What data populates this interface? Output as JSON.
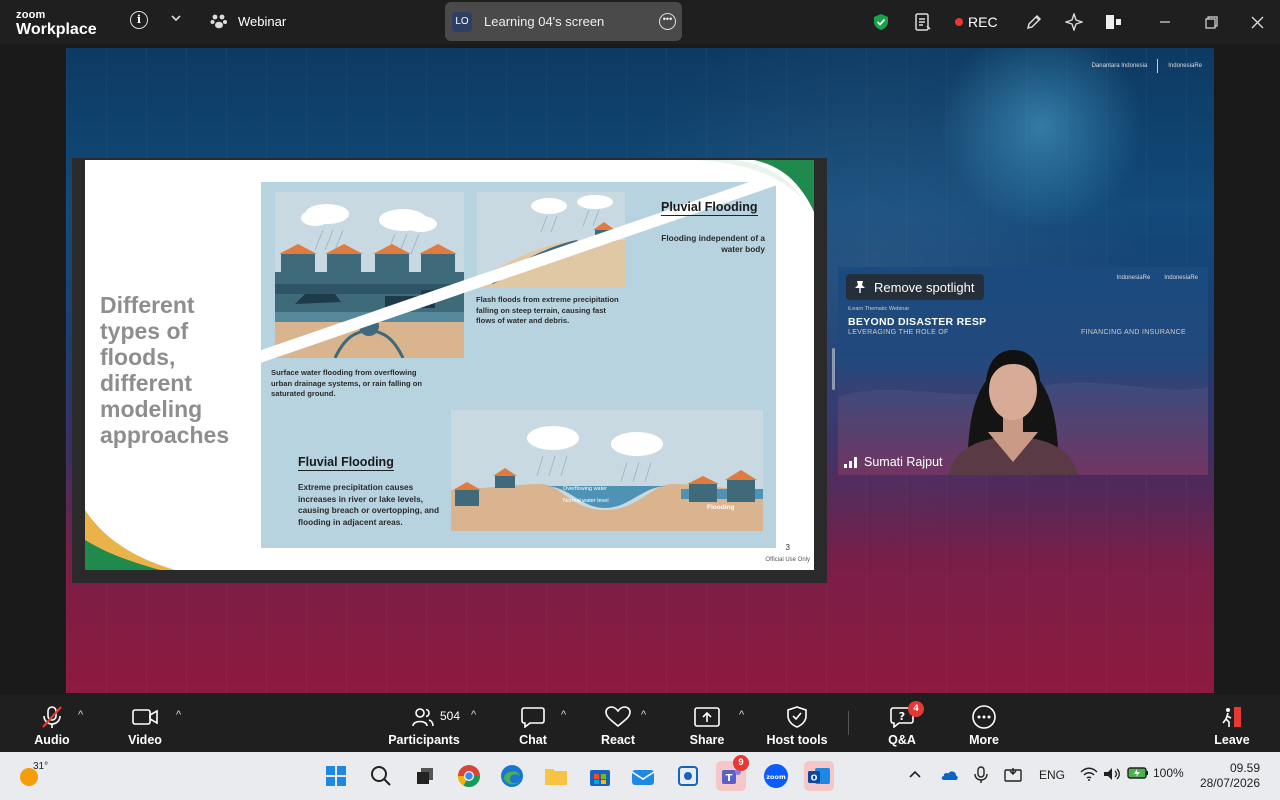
{
  "titlebar": {
    "logo_top": "zoom",
    "logo_bottom": "Workplace",
    "info_glyph": "i",
    "webinar_label": "Webinar",
    "share_badge": "LO",
    "share_label": "Learning 04's screen",
    "rec_label": "REC"
  },
  "stage": {
    "logo_left": "Danantara Indonesia",
    "logo_right": "IndonesiaRe"
  },
  "slide": {
    "title": "Different types of floods, different modeling approaches",
    "pluvial_title": "Pluvial Flooding",
    "pluvial_desc": "Flooding independent of a water body",
    "flash_desc": "Flash floods from extreme precipitation falling on steep terrain, causing fast flows of water and debris.",
    "surface_desc": "Surface water flooding from overflowing urban drainage systems, or rain falling on saturated ground.",
    "fluvial_title": "Fluvial Flooding",
    "fluvial_desc": "Extreme precipitation causes increases in river or lake levels, causing breach or overtopping, and flooding in adjacent areas.",
    "overflow_label": "Overflowing water",
    "normal_label": "Normal water level",
    "flooding_label": "Flooding",
    "page_number": "3",
    "footer": "Official Use Only"
  },
  "video": {
    "remove_spotlight": "Remove spotlight",
    "banner_small": "iLearn Thematic Webinar",
    "banner_title": "BEYOND DISASTER RESP",
    "banner_sub_left": "LEVERAGING THE ROLE OF",
    "banner_sub_right": "FINANCING AND INSURANCE",
    "logo_a": "IndonesiaRe",
    "logo_b": "IndonesiaRe",
    "participant_name": "Sumati Rajput"
  },
  "toolbar": {
    "audio": "Audio",
    "video": "Video",
    "participants": "Participants",
    "participants_count": "504",
    "chat": "Chat",
    "react": "React",
    "share": "Share",
    "host_tools": "Host tools",
    "qa": "Q&A",
    "qa_badge": "4",
    "more": "More",
    "leave": "Leave"
  },
  "taskbar": {
    "weather_temp": "31°",
    "teams_badge": "9",
    "lang": "ENG",
    "battery": "100%",
    "time": "09.59",
    "date": "28/07/2026"
  },
  "colors": {
    "accent_green": "#16a34a",
    "rec_red": "#e53935",
    "slide_panel": "#b8d3e0",
    "house_teal": "#3f6a7a",
    "roof_orange": "#e07a3f"
  }
}
